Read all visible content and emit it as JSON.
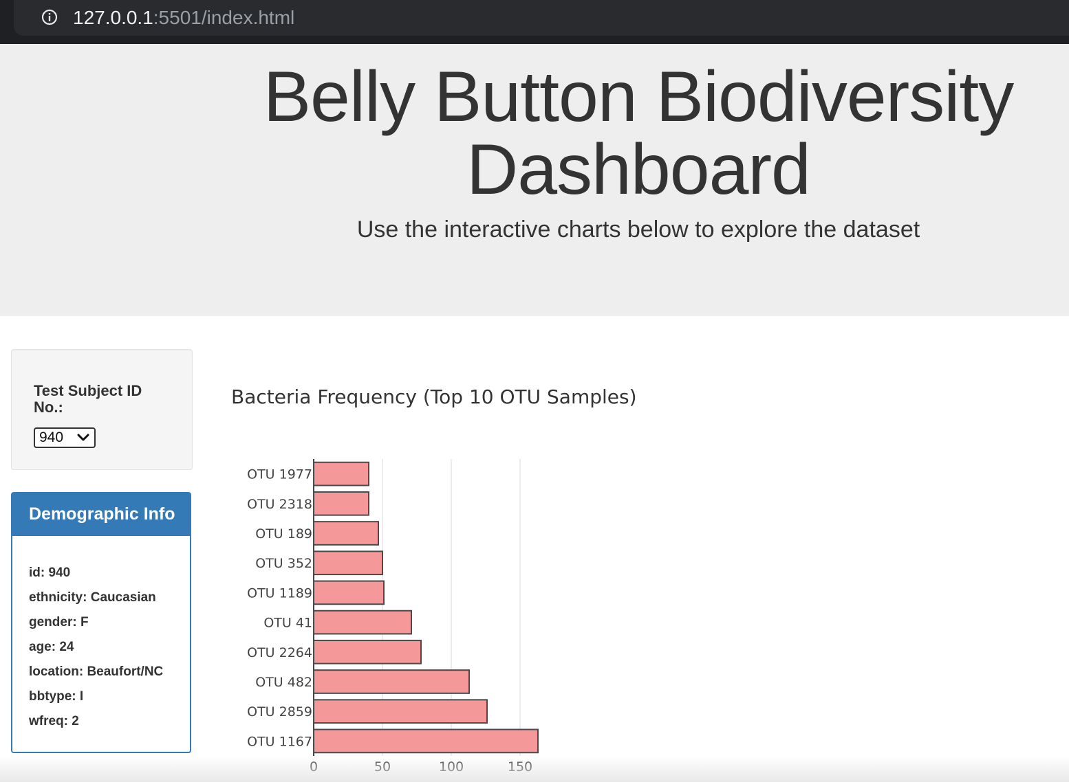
{
  "browser": {
    "url_host": "127.0.0.1",
    "url_rest": ":5501/index.html",
    "icons": {
      "info": "info-circle-icon"
    }
  },
  "header": {
    "title": "Belly Button Biodiversity Dashboard",
    "subtitle": "Use the interactive charts below to explore the dataset"
  },
  "selector": {
    "label": "Test Subject ID No.:",
    "selected": "940",
    "icons": {
      "dropdown": "chevron-down-icon"
    }
  },
  "demographics": {
    "title": "Demographic Info",
    "items": [
      "id: 940",
      "ethnicity: Caucasian",
      "gender: F",
      "age: 24",
      "location: Beaufort/NC",
      "bbtype: I",
      "wfreq: 2"
    ]
  },
  "colors": {
    "bar_fill": "#f4989a",
    "bar_stroke": "#4a4a4a",
    "panel_blue": "#337ab7",
    "jumbotron_bg": "#eeeeee"
  },
  "chart_data": {
    "type": "bar",
    "orientation": "horizontal",
    "title": "Bacteria Frequency (Top 10 OTU Samples)",
    "categories": [
      "OTU 1167",
      "OTU 2859",
      "OTU 482",
      "OTU 2264",
      "OTU 41",
      "OTU 1189",
      "OTU 352",
      "OTU 189",
      "OTU 2318",
      "OTU 1977"
    ],
    "values": [
      163,
      126,
      113,
      78,
      71,
      51,
      50,
      47,
      40,
      40
    ],
    "xlim": [
      0,
      170
    ],
    "xticks": [
      0,
      50,
      100,
      150
    ],
    "grid": true
  }
}
